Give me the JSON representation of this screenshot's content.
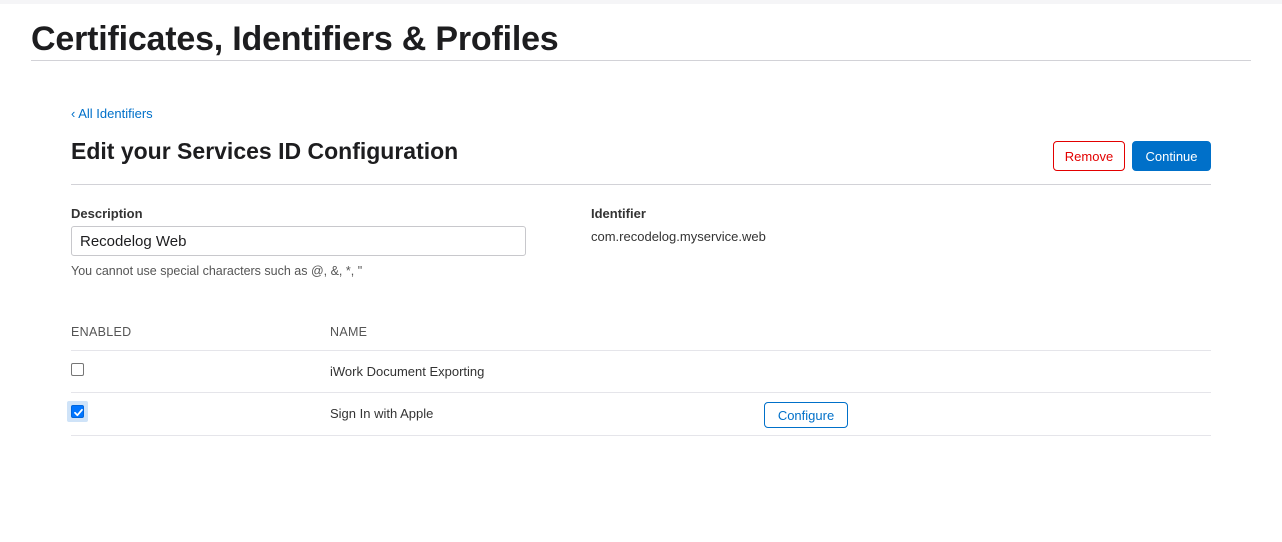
{
  "header": {
    "title": "Certificates, Identifiers & Profiles"
  },
  "nav": {
    "back_link": "‹ All Identifiers"
  },
  "section": {
    "title": "Edit your Services ID Configuration",
    "remove_label": "Remove",
    "continue_label": "Continue"
  },
  "form": {
    "description_label": "Description",
    "description_value": "Recodelog Web",
    "description_hint": "You cannot use special characters such as @, &, *, \"",
    "identifier_label": "Identifier",
    "identifier_value": "com.recodelog.myservice.web"
  },
  "services_table": {
    "columns": [
      "ENABLED",
      "NAME"
    ],
    "rows": [
      {
        "name": "iWork Document Exporting",
        "enabled": false
      },
      {
        "name": "Sign In with Apple",
        "enabled": true,
        "action_label": "Configure"
      }
    ]
  },
  "colors": {
    "accent": "#0070c9",
    "danger": "#e30000",
    "checkbox_checked": "#0075ff"
  }
}
